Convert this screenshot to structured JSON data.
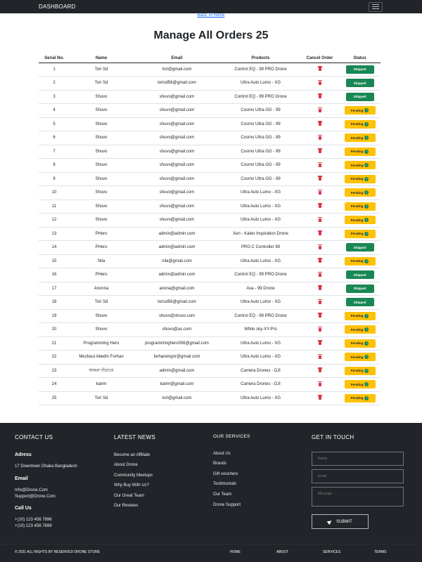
{
  "navbar": {
    "brand": "DASHBOARD",
    "menu_icon": "hamburger-icon"
  },
  "back_link": "Back To Home",
  "page_title": "Manage All Orders 25",
  "table": {
    "headers": [
      "Serial No.",
      "Name",
      "Email",
      "Products",
      "Cancel Order",
      "Status"
    ],
    "cancel_icon": "trash-icon",
    "rows": [
      {
        "serial": "1",
        "name": "Tori Sd",
        "email": "tori@gmail.com",
        "product": "Control EQ - 99 PRO Drone",
        "status": "Shipped"
      },
      {
        "serial": "2",
        "name": "Tori Sd",
        "email": "torisd56@gmail.com",
        "product": "Ultra Auto Lumo - XG",
        "status": "Shipped"
      },
      {
        "serial": "3",
        "name": "Shuvo",
        "email": "shuvo@gmail.com",
        "product": "Control EQ - 99 PRO Drone",
        "status": "Shipped"
      },
      {
        "serial": "4",
        "name": "Shuvo",
        "email": "shuvo@gmail.com",
        "product": "Cosmo Ultra GG - 99",
        "status": "Pending"
      },
      {
        "serial": "5",
        "name": "Shuvo",
        "email": "shuvo@gmail.com",
        "product": "Cosmo Ultra GG - 99",
        "status": "Pending"
      },
      {
        "serial": "6",
        "name": "Shuvo",
        "email": "shuvo@gmail.com",
        "product": "Cosmo Ultra GG - 99",
        "status": "Pending"
      },
      {
        "serial": "7",
        "name": "Shuvo",
        "email": "shuvo@gmail.com",
        "product": "Cosmo Ultra GG - 99",
        "status": "Pending"
      },
      {
        "serial": "8",
        "name": "Shuvo",
        "email": "shuvo@gmail.com",
        "product": "Cosmo Ultra GG - 99",
        "status": "Pending"
      },
      {
        "serial": "9",
        "name": "Shuvo",
        "email": "shuvo@gmail.com",
        "product": "Cosmo Ultra GG - 99",
        "status": "Pending"
      },
      {
        "serial": "10",
        "name": "Shuvo",
        "email": "shuvo@gmail.com",
        "product": "Ultra Auto Lumo - XG",
        "status": "Pending"
      },
      {
        "serial": "11",
        "name": "Shuvo",
        "email": "shuvo@gmail.com",
        "product": "Ultra Auto Lumo - XG",
        "status": "Pending"
      },
      {
        "serial": "12",
        "name": "Shuvo",
        "email": "shuvo@gmail.com",
        "product": "Ultra Auto Lumo - XG",
        "status": "Pending"
      },
      {
        "serial": "13",
        "name": "PHero",
        "email": "admin@admin.com",
        "product": "Xen - Kaleo Inspiration Drone",
        "status": "Pending"
      },
      {
        "serial": "14",
        "name": "PHero",
        "email": "admin@admin.com",
        "product": "PRO C Controller 99",
        "status": "Shipped"
      },
      {
        "serial": "15",
        "name": "Nila",
        "email": "nila@gmail.com",
        "product": "Ultra Auto Lumo - XG",
        "status": "Pending"
      },
      {
        "serial": "16",
        "name": "PHero",
        "email": "admin@admin.com",
        "product": "Control EQ - 99 PRO Drone",
        "status": "Shipped"
      },
      {
        "serial": "17",
        "name": "Anonna",
        "email": "anona@gmail.com",
        "product": "Ava - 99 Drone",
        "status": "Shipped"
      },
      {
        "serial": "18",
        "name": "Tori Sd",
        "email": "torisd56@gmail.com",
        "product": "Ultra Auto Lumo - XG",
        "status": "Shipped"
      },
      {
        "serial": "19",
        "name": "Shuvo",
        "email": "shuvo@shuvo.com",
        "product": "Control EQ - 99 PRO Drone",
        "status": "Pending"
      },
      {
        "serial": "20",
        "name": "Shuvo",
        "email": "shuvo@as.com",
        "product": "White sky-XY-Pro",
        "status": "Pending"
      },
      {
        "serial": "21",
        "name": "Programming Hero",
        "email": "programminghero006@gmail.com",
        "product": "Ultra Auto Lumo - XG",
        "status": "Pending"
      },
      {
        "serial": "22",
        "name": "Mezbaul Abedin Forhan",
        "email": "farhanengnr@gmail.com",
        "product": "Ultra Auto Lumo - XG",
        "status": "Pending"
      },
      {
        "serial": "23",
        "name": "আমরা দাঁড়াবো",
        "email": "admin@gmail.com",
        "product": "Camera Drones - DJI",
        "status": "Pending"
      },
      {
        "serial": "24",
        "name": "karim",
        "email": "karim@gmail.com",
        "product": "Camera Drones - DJI",
        "status": "Pending"
      },
      {
        "serial": "25",
        "name": "Tori Sd",
        "email": "tori@gmail.com",
        "product": "Ultra Auto Lumo - XG",
        "status": "Pending"
      }
    ]
  },
  "footer": {
    "contact": {
      "heading": "CONTACT US",
      "address_label": "Adress",
      "address": "17 Downtown Dhaka Bangladesh",
      "email_label": "Email",
      "emails": [
        "Info@Drone.Com",
        "Support@Drone.Com"
      ],
      "call_label": "Call Us",
      "phones": [
        "+(10) 123 456 7896",
        "+(10) 123 456 7899"
      ]
    },
    "news": {
      "heading": "LATEST NEWS",
      "links": [
        "Become an Affiliate",
        "About Drone",
        "Community Meetups",
        "Why Buy With Us?",
        "Our Great Team",
        "Our Reviews"
      ]
    },
    "services": {
      "heading": "OUR SERVICES",
      "links": [
        "About Us",
        "Brands",
        "Gift vouchers",
        "Testimonials",
        "Our Team",
        "Drone Support"
      ]
    },
    "touch": {
      "heading": "GET IN TOUCH",
      "name_placeholder": "Name",
      "email_placeholder": "Email",
      "message_placeholder": "Message",
      "submit_label": "SUBMIT",
      "submit_icon": "paper-plane-icon"
    },
    "copyright": "© 2021 ALL RIGHTS BY RESERVED DRONE STORE",
    "bottom_links": [
      "HOME",
      "ABOUT",
      "SERVICES",
      "TERMS"
    ]
  },
  "colors": {
    "shipped": "#198754",
    "pending": "#ffc107",
    "danger": "#dc3545",
    "dark": "#212529",
    "link": "#0d6efd"
  }
}
